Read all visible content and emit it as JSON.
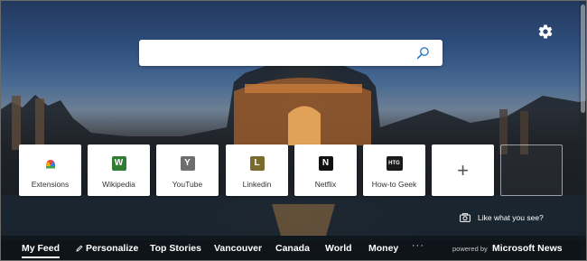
{
  "search": {
    "placeholder": "",
    "value": ""
  },
  "settings": {
    "icon": "gear-icon"
  },
  "tiles": [
    {
      "label": "Extensions",
      "logo": "",
      "icon": "extensions-icon"
    },
    {
      "label": "Wikipedia",
      "logo": "W",
      "color": "#2e7d32"
    },
    {
      "label": "YouTube",
      "logo": "Y",
      "color": "#6d6d6d"
    },
    {
      "label": "Linkedin",
      "logo": "L",
      "color": "#7a6a2d"
    },
    {
      "label": "Netflix",
      "logo": "N",
      "color": "#111111"
    },
    {
      "label": "How-to Geek",
      "logo": "HTG",
      "color": "#1a1a1a"
    }
  ],
  "add_tile": {
    "symbol": "+"
  },
  "like_prompt": {
    "text": "Like what you see?"
  },
  "nav": {
    "items": [
      "My Feed",
      "Personalize",
      "Top Stories",
      "Vancouver",
      "Canada",
      "World",
      "Money"
    ],
    "active": "My Feed",
    "more": "···"
  },
  "footer": {
    "powered_by": "powered by",
    "brand": "Microsoft News"
  }
}
